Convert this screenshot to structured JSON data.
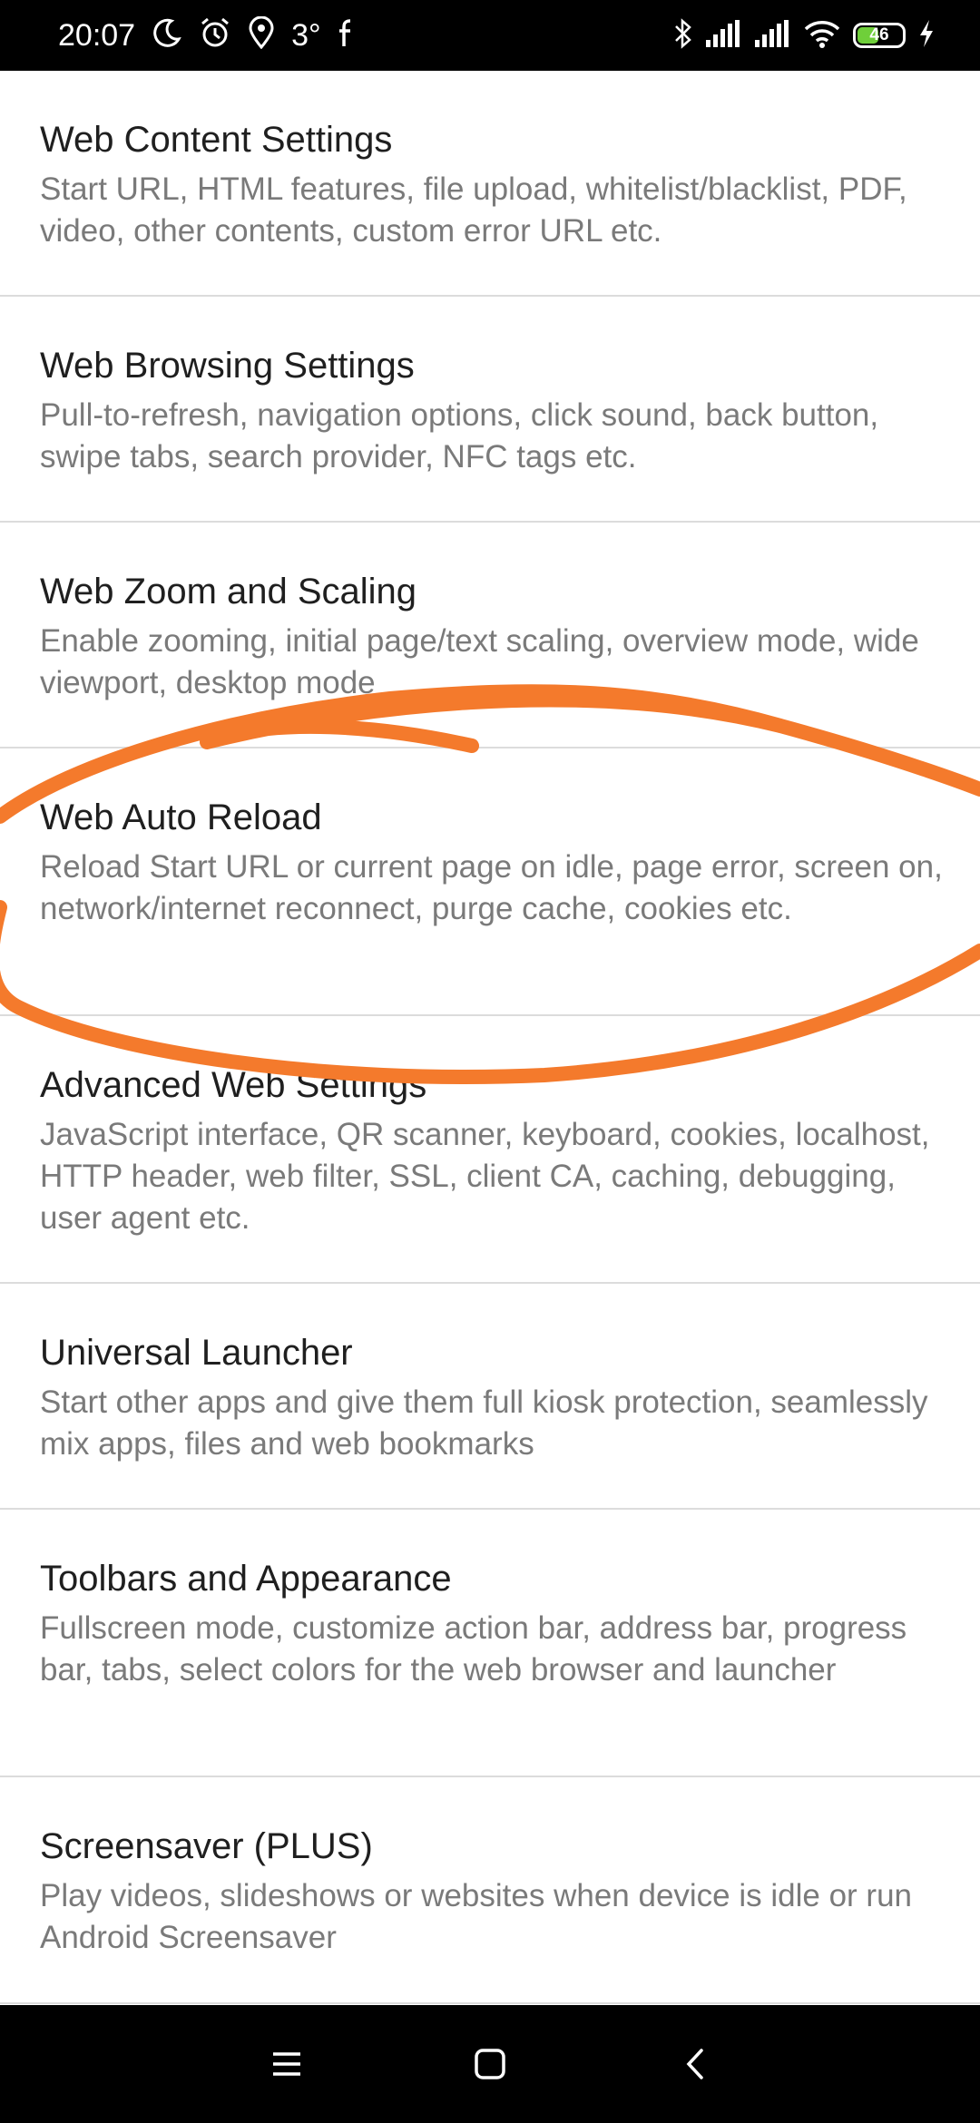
{
  "status_bar": {
    "time": "20:07",
    "temperature": "3°",
    "battery_level": "46",
    "left_icons": [
      "moon-icon",
      "alarm-icon",
      "location-icon",
      "facebook-icon"
    ],
    "right_icons": [
      "bluetooth-icon",
      "signal-icon",
      "signal-icon",
      "wifi-icon",
      "battery-icon",
      "charging-icon"
    ]
  },
  "settings": [
    {
      "title": "Web Content Settings",
      "subtitle": "Start URL, HTML features, file upload, whitelist/blacklist, PDF, video, other contents, custom error URL etc."
    },
    {
      "title": "Web Browsing Settings",
      "subtitle": "Pull-to-refresh, navigation options, click sound, back button, swipe tabs, search provider, NFC tags etc."
    },
    {
      "title": "Web Zoom and Scaling",
      "subtitle": "Enable zooming, initial page/text scaling, overview mode, wide viewport, desktop mode"
    },
    {
      "title": "Web Auto Reload",
      "subtitle": "Reload Start URL or current page on idle, page error, screen on, network/internet reconnect, purge cache, cookies etc."
    },
    {
      "title": "Advanced Web Settings",
      "subtitle": "JavaScript interface, QR scanner, keyboard, cookies, localhost, HTTP header, web filter, SSL, client CA, caching, debugging, user agent etc."
    },
    {
      "title": "Universal Launcher",
      "subtitle": "Start other apps and give them full kiosk protection, seamlessly mix apps, files and web bookmarks"
    },
    {
      "title": "Toolbars and Appearance",
      "subtitle": "Fullscreen mode, customize action bar, address bar, progress bar, tabs, select colors for the web browser and launcher"
    },
    {
      "title": "Screensaver (PLUS)",
      "subtitle": "Play videos, slideshows or websites when device is idle or run Android Screensaver"
    }
  ],
  "nav_bar": {
    "icons": [
      "menu-icon",
      "home-icon",
      "back-icon"
    ]
  },
  "annotation": {
    "color": "#f47a2c",
    "shape": "hand-drawn ellipse around Web Auto Reload"
  }
}
